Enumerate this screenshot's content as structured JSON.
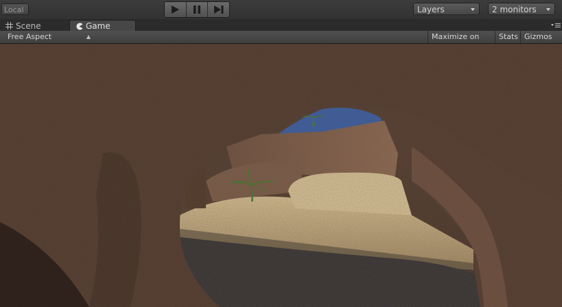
{
  "toolbar": {
    "pivot_label": "Local",
    "play_icons": [
      "play-icon",
      "pause-icon",
      "step-icon"
    ],
    "layers_label": "Layers",
    "layout_label": "2 monitors"
  },
  "tabs": [
    {
      "label": "Scene",
      "icon": "grid-icon",
      "active": false
    },
    {
      "label": "Game",
      "icon": "pacman-icon",
      "active": true
    }
  ],
  "game_view": {
    "aspect_label": "Free Aspect",
    "maximize_label": "Maximize on Play",
    "stats_label": "Stats",
    "gizmos_label": "Gizmos"
  },
  "colors": {
    "editor_bg": "#383838",
    "cave_rock": "#4a3327",
    "sky": "#2f5db0",
    "sand": "#d8bf8e",
    "water": "#2c2d30"
  }
}
